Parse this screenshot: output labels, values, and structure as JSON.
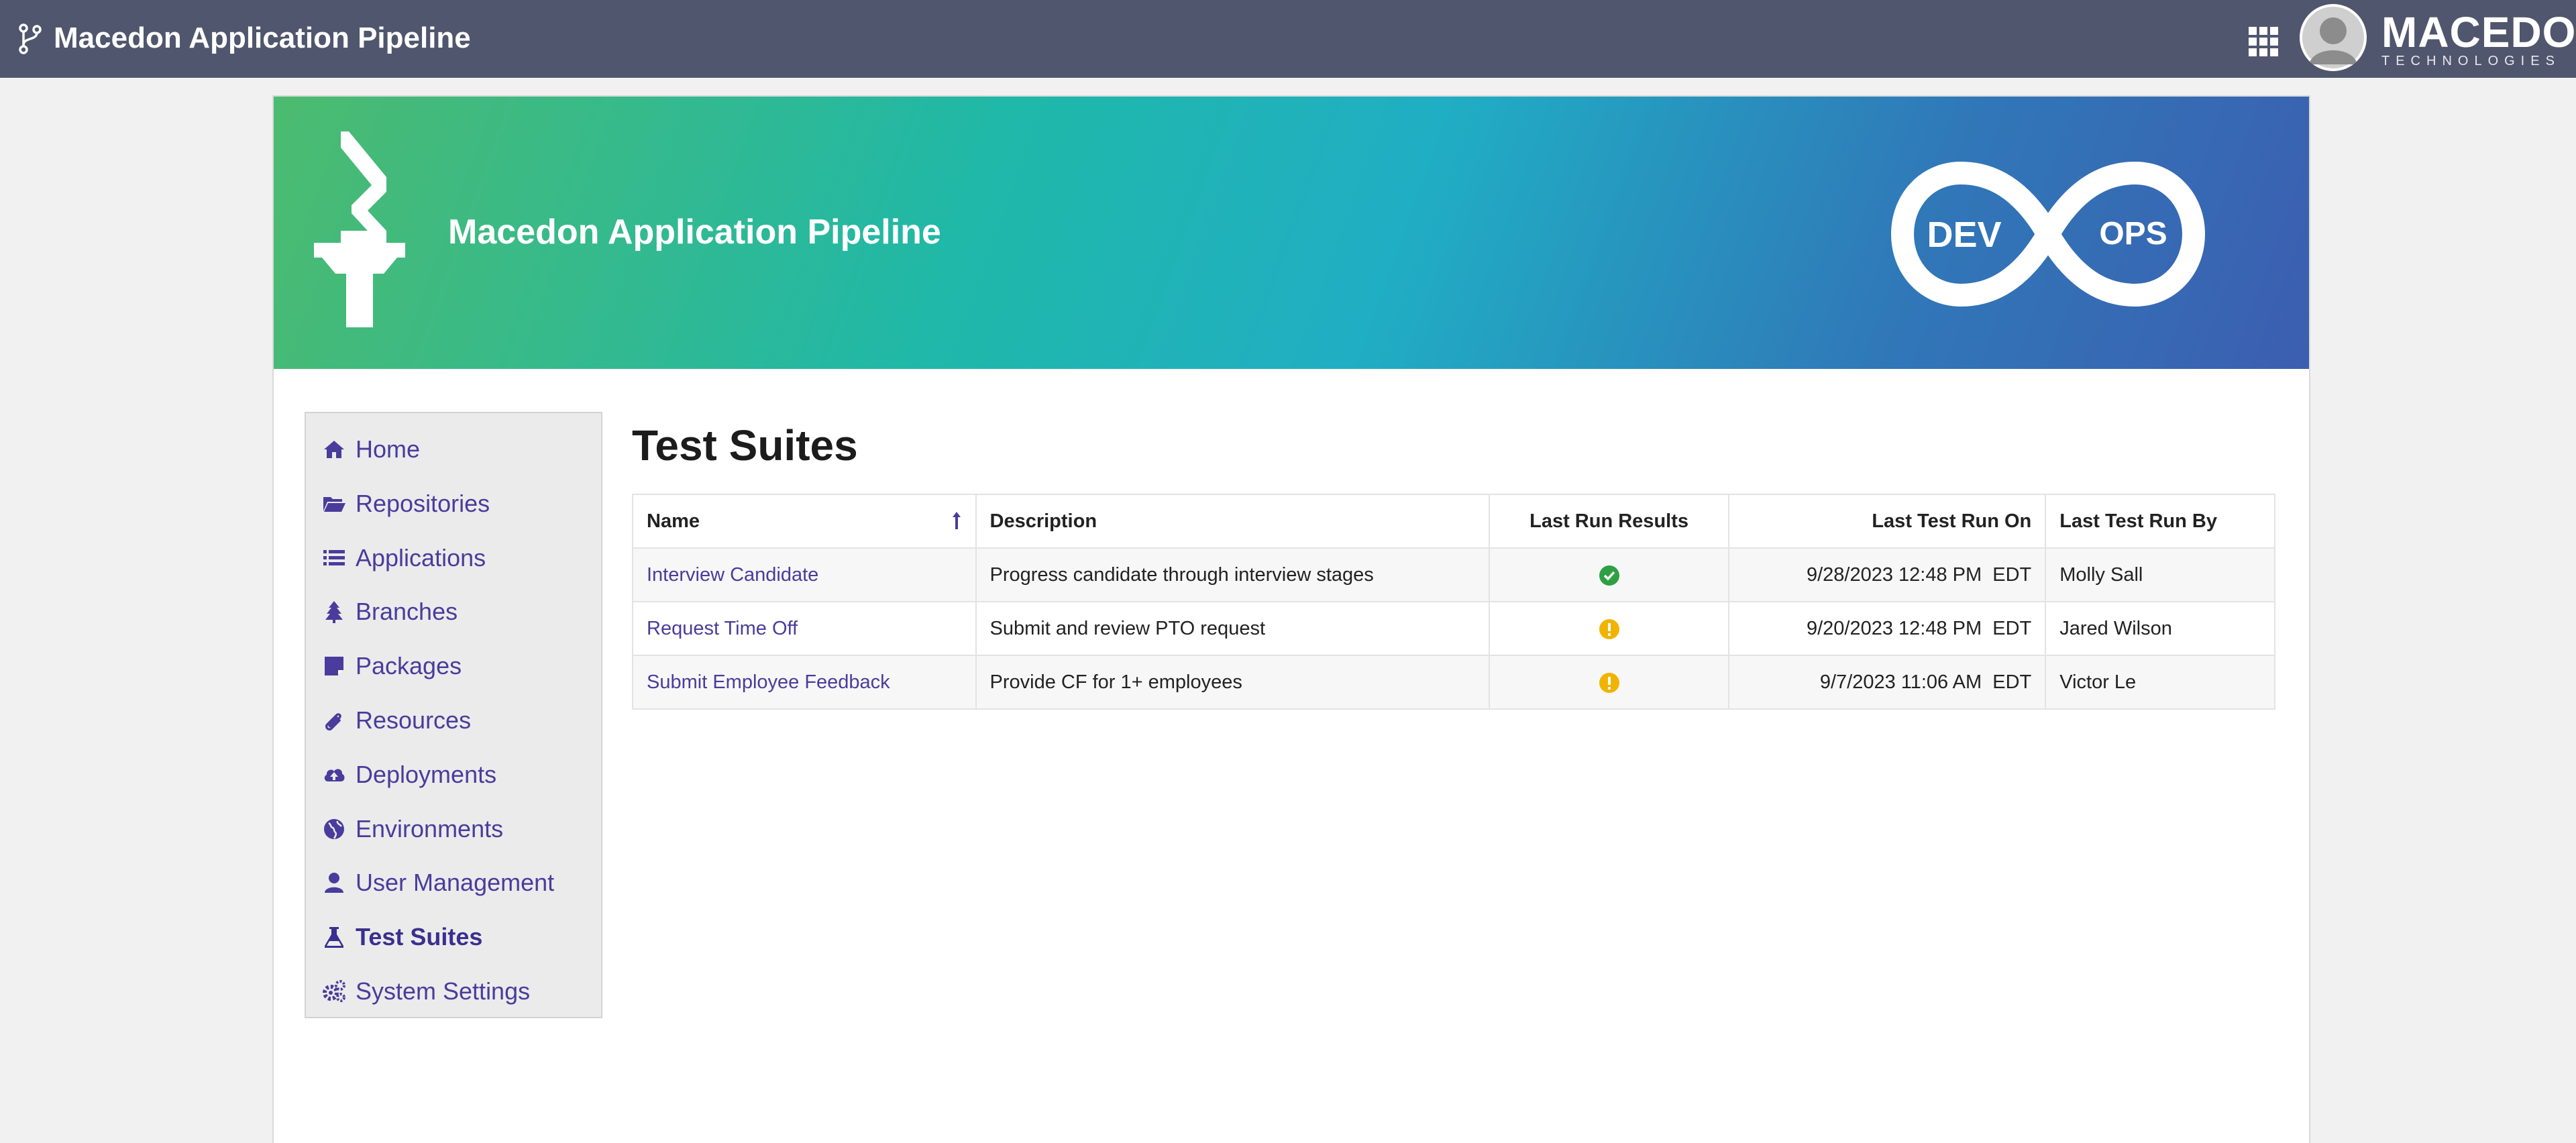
{
  "topbar": {
    "title": "Macedon Application Pipeline",
    "brand_name": "MACEDON",
    "brand_sub": "TECHNOLOGIES"
  },
  "banner": {
    "title": "Macedon Application Pipeline",
    "devops_left": "DEV",
    "devops_right": "OPS"
  },
  "sidebar": {
    "items": [
      {
        "label": "Home",
        "icon": "home-icon"
      },
      {
        "label": "Repositories",
        "icon": "folder-open-icon"
      },
      {
        "label": "Applications",
        "icon": "list-icon"
      },
      {
        "label": "Branches",
        "icon": "tree-icon"
      },
      {
        "label": "Packages",
        "icon": "package-icon"
      },
      {
        "label": "Resources",
        "icon": "paperclip-icon"
      },
      {
        "label": "Deployments",
        "icon": "cloud-upload-icon"
      },
      {
        "label": "Environments",
        "icon": "globe-icon"
      },
      {
        "label": "User Management",
        "icon": "user-icon"
      },
      {
        "label": "Test Suites",
        "icon": "flask-icon",
        "active": true
      },
      {
        "label": "System Settings",
        "icon": "cogs-icon"
      }
    ]
  },
  "main": {
    "title": "Test Suites",
    "table": {
      "headers": [
        "Name",
        "Description",
        "Last Run Results",
        "Last Test Run On",
        "Last Test Run By"
      ],
      "rows": [
        {
          "name": "Interview Candidate",
          "description": "Progress candidate through interview stages",
          "result": "success",
          "run_on": "9/28/2023 12:48 PM  EDT",
          "run_by": "Molly Sall"
        },
        {
          "name": "Request Time Off",
          "description": "Submit and review PTO request",
          "result": "warning",
          "run_on": "9/20/2023 12:48 PM  EDT",
          "run_by": "Jared Wilson"
        },
        {
          "name": "Submit Employee Feedback",
          "description": "Provide CF for 1+ employees",
          "result": "warning",
          "run_on": "9/7/2023 11:06 AM  EDT",
          "run_by": "Victor Le"
        }
      ]
    }
  },
  "colors": {
    "topbar": "#50566d",
    "link": "#4a3c9c",
    "success": "#2ea043",
    "warning": "#f0b400"
  }
}
